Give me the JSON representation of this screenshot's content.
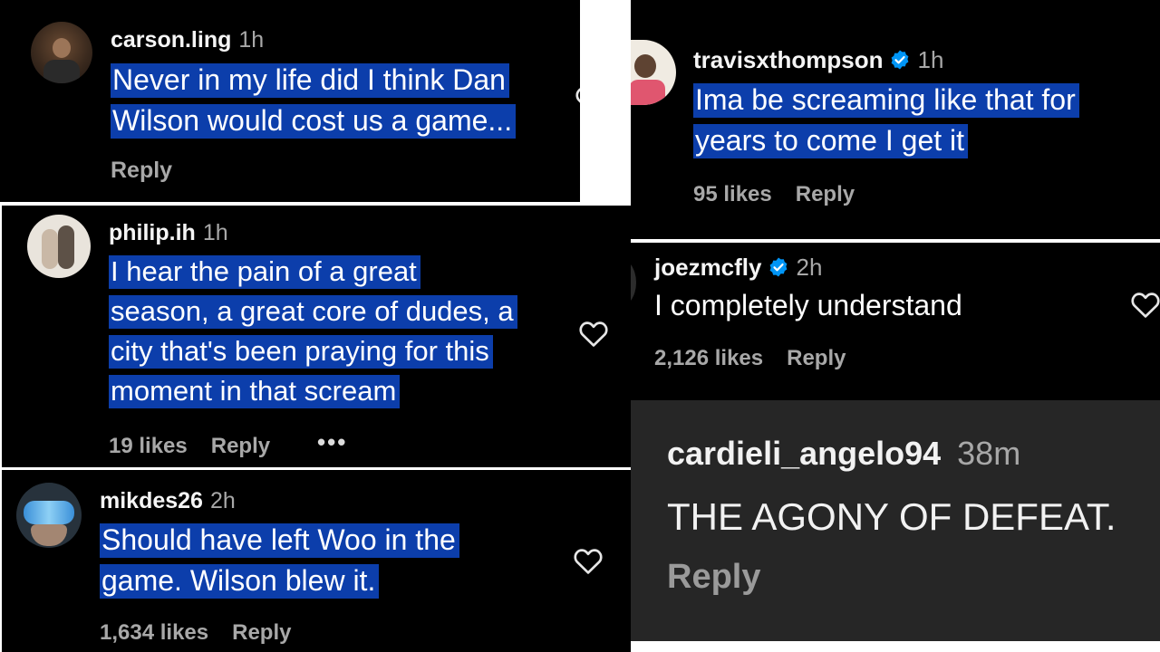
{
  "comments": [
    {
      "username": "carson.ling",
      "time": "1h",
      "text_lines": [
        "Never in my life did I think Dan",
        "Wilson would cost us a game..."
      ],
      "reply": "Reply"
    },
    {
      "username": "philip.ih",
      "time": "1h",
      "text_lines": [
        "I hear the pain of a great",
        "season, a great core of dudes, a",
        "city that's been praying for this",
        "moment in that scream"
      ],
      "likes": "19 likes",
      "reply": "Reply",
      "more": "•••"
    },
    {
      "username": "mikdes26",
      "time": "2h",
      "text_lines": [
        "Should have left Woo in the",
        "game. Wilson blew it."
      ],
      "likes": "1,634 likes",
      "reply": "Reply"
    },
    {
      "username": "travisxthompson",
      "time": "1h",
      "verified": true,
      "text_lines": [
        "Ima be screaming like that for",
        "years to come I get it"
      ],
      "likes": "95 likes",
      "reply": "Reply"
    },
    {
      "username": "joezmcfly",
      "time": "2h",
      "verified": true,
      "text": "I completely understand",
      "likes": "2,126 likes",
      "reply": "Reply"
    },
    {
      "username": "cardieli_angelo94",
      "time": "38m",
      "text": "THE AGONY OF DEFEAT.",
      "reply": "Reply"
    }
  ],
  "icons": {
    "like": "heart-outline-icon",
    "verified": "verified-badge-icon",
    "verified_color": "#0095f6"
  },
  "colors": {
    "highlight": "#0c3eab",
    "panel_bg": "#000000",
    "panel_dark_bg": "#262626",
    "muted_text": "#a8a8a8"
  }
}
